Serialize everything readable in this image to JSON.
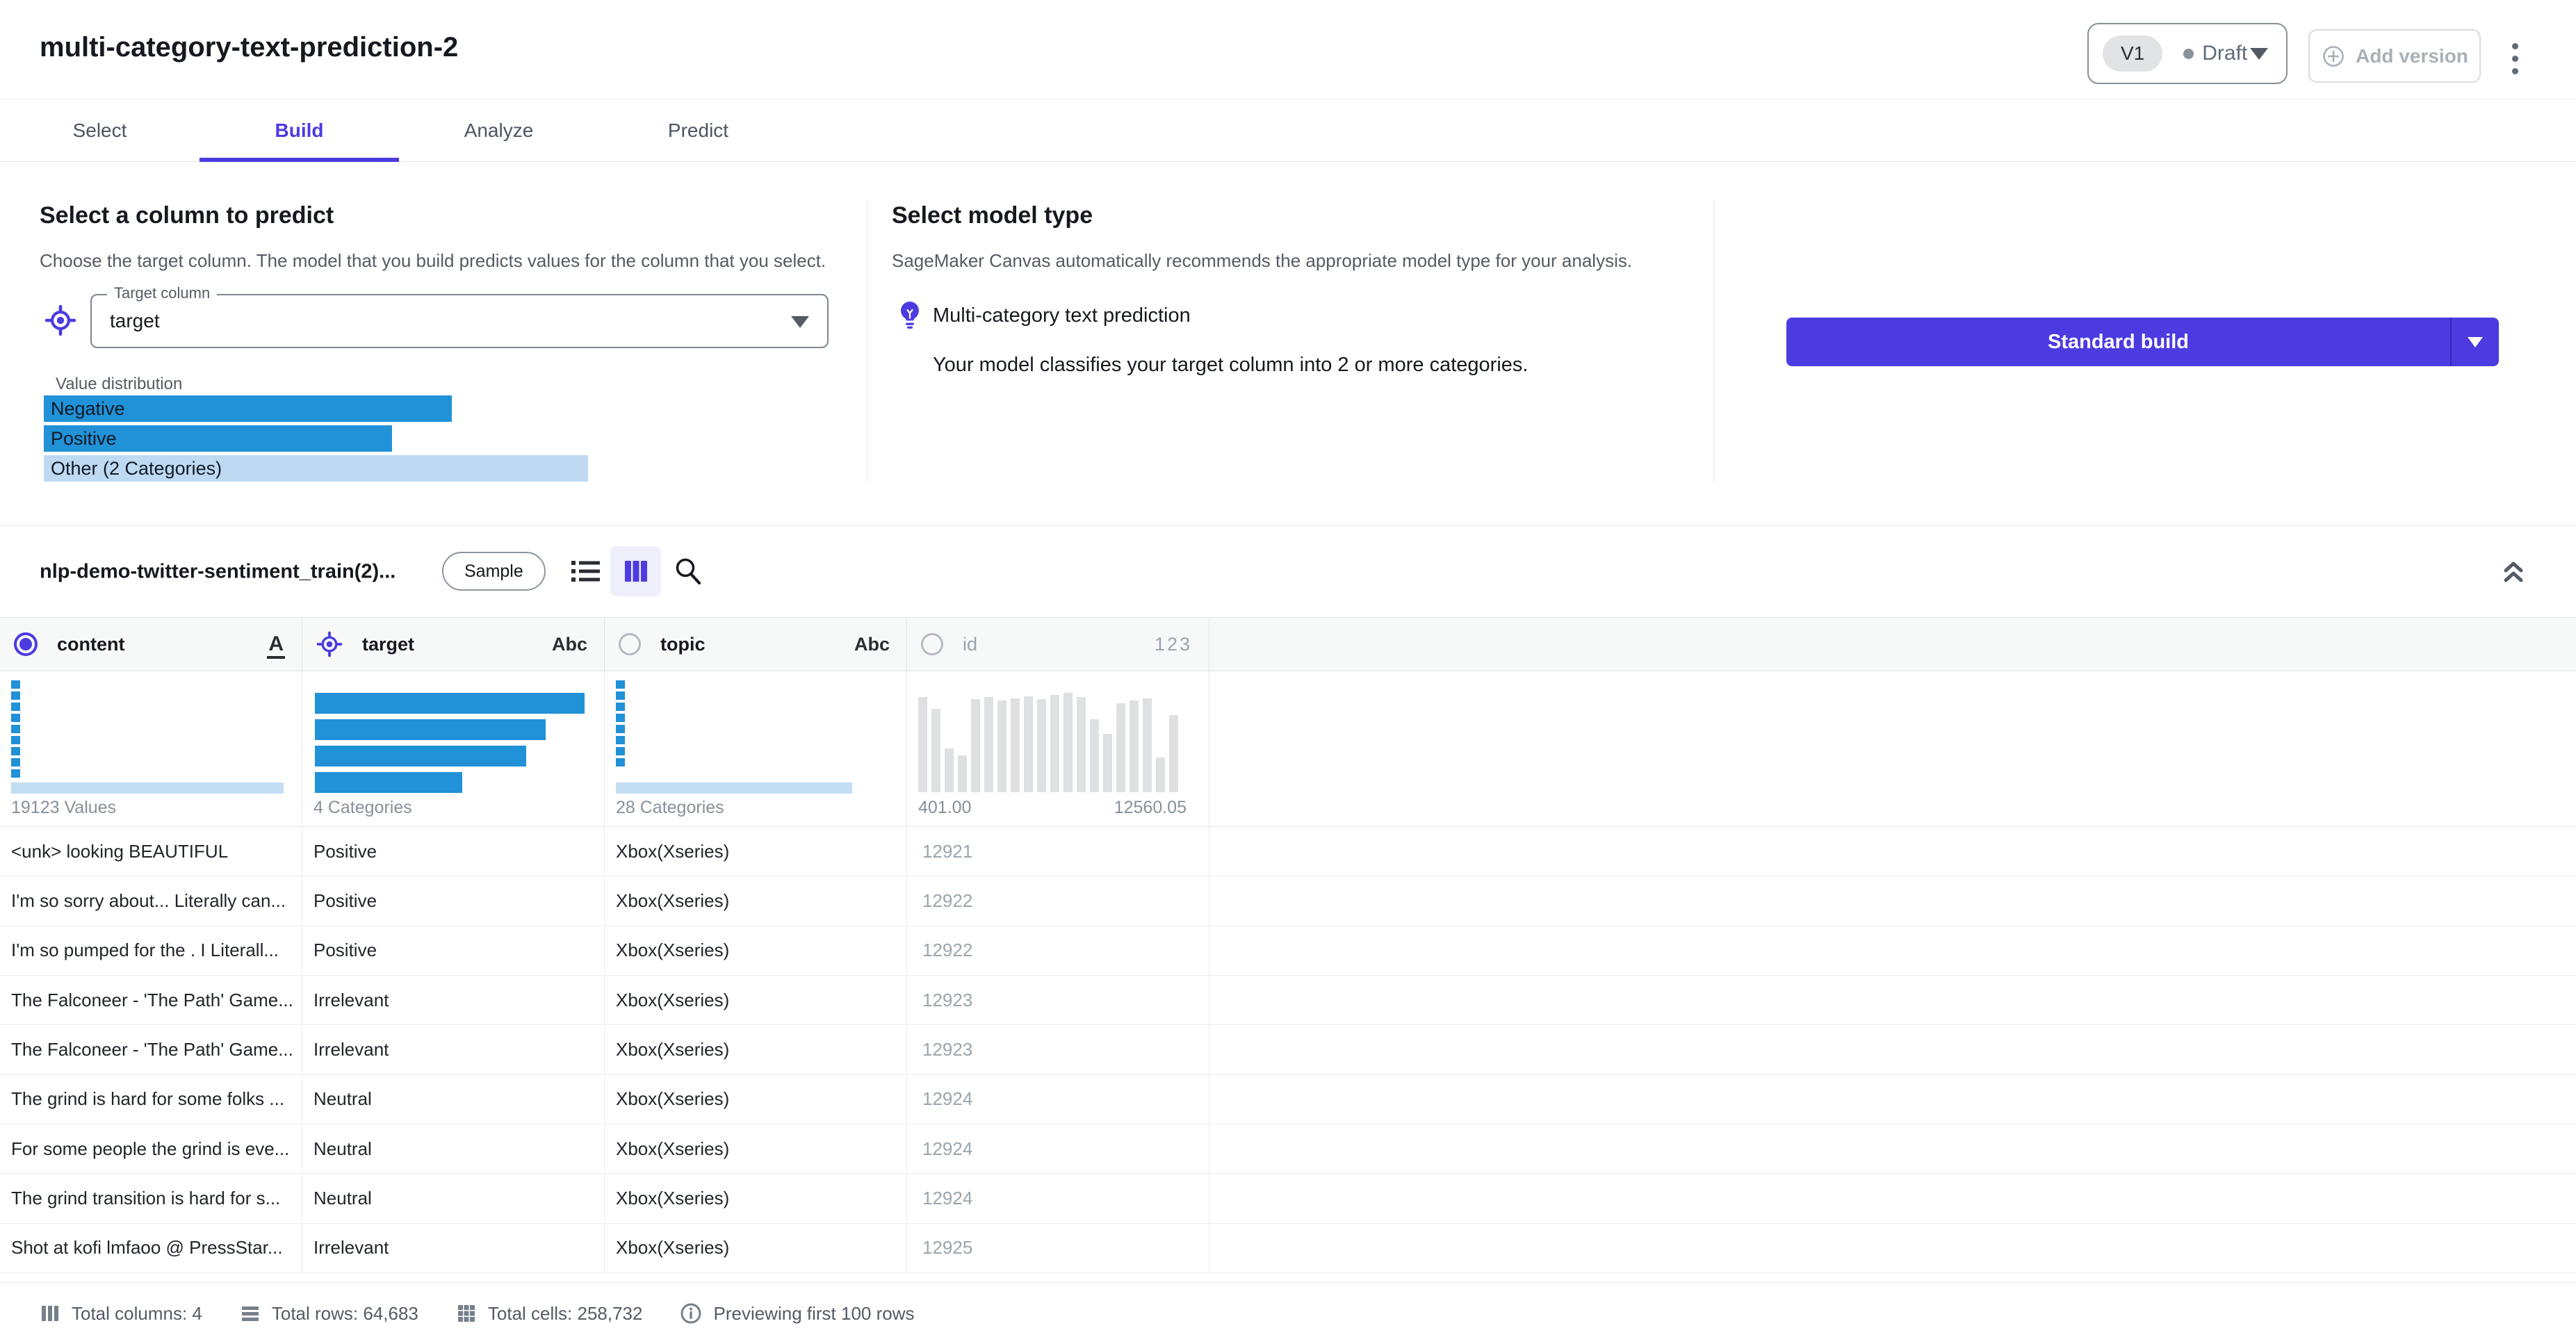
{
  "colors": {
    "accent": "#4b3be0",
    "bar_blue": "#2191d8",
    "bar_light_blue": "#bddaf2",
    "histogram_gray": "#dfe0e2",
    "muted_text": "#9aa5ad"
  },
  "header": {
    "title": "multi-category-text-prediction-2",
    "version_badge": "V1",
    "status": "Draft",
    "add_version_label": "Add version"
  },
  "tabs": [
    {
      "label": "Select",
      "active": false
    },
    {
      "label": "Build",
      "active": true
    },
    {
      "label": "Analyze",
      "active": false
    },
    {
      "label": "Predict",
      "active": false
    }
  ],
  "target_panel": {
    "heading": "Select a column to predict",
    "description": "Choose the target column. The model that you build predicts values for the column that you select.",
    "field_label": "Target column",
    "field_value": "target",
    "distribution_label": "Value distribution",
    "bars": [
      {
        "label": "Negative",
        "width_pct": 75,
        "light": false
      },
      {
        "label": "Positive",
        "width_pct": 64,
        "light": false
      },
      {
        "label": "Other (2 Categories)",
        "width_pct": 100,
        "light": true
      }
    ]
  },
  "model_panel": {
    "heading": "Select model type",
    "description": "SageMaker Canvas automatically recommends the appropriate model type for your analysis.",
    "model_name": "Multi-category text prediction",
    "model_detail": "Your model classifies your target column into 2 or more categories."
  },
  "build": {
    "primary_label": "Standard build"
  },
  "dataset": {
    "name": "nlp-demo-twitter-sentiment_train(2)...",
    "badge": "Sample"
  },
  "table": {
    "columns": [
      {
        "name": "content",
        "type": "A",
        "icon": "radio-selected",
        "muted": false
      },
      {
        "name": "target",
        "type": "Abc",
        "icon": "target",
        "muted": false
      },
      {
        "name": "topic",
        "type": "Abc",
        "icon": "radio",
        "muted": false
      },
      {
        "name": "id",
        "type": "123",
        "icon": "radio",
        "muted": true
      }
    ],
    "histograms": [
      {
        "kind": "squares",
        "squares": 9,
        "flat_bar_pct": 98,
        "caption": "19123 Values"
      },
      {
        "kind": "hbars",
        "widths_pct": [
          97,
          83,
          76,
          53
        ],
        "caption": "4 Categories"
      },
      {
        "kind": "squares",
        "squares": 8,
        "flat_bar_pct": 85,
        "caption": "28 Categories"
      },
      {
        "kind": "vbars",
        "values_pct": [
          95,
          83,
          44,
          37,
          93,
          95,
          92,
          94,
          96,
          93,
          97,
          99,
          95,
          73,
          58,
          89,
          92,
          94,
          35,
          77
        ],
        "min_label": "401.00",
        "max_label": "12560.05"
      }
    ],
    "rows": [
      [
        "<unk> looking BEAUTIFUL",
        "Positive",
        "Xbox(Xseries)",
        "12921"
      ],
      [
        "I'm so sorry about... Literally can...",
        "Positive",
        "Xbox(Xseries)",
        "12922"
      ],
      [
        "I'm so pumped for the . I Literall...",
        "Positive",
        "Xbox(Xseries)",
        "12922"
      ],
      [
        "The Falconeer - 'The Path' Game...",
        "Irrelevant",
        "Xbox(Xseries)",
        "12923"
      ],
      [
        "The Falconeer - 'The Path' Game...",
        "Irrelevant",
        "Xbox(Xseries)",
        "12923"
      ],
      [
        "The grind is hard for some folks ...",
        "Neutral",
        "Xbox(Xseries)",
        "12924"
      ],
      [
        "For some people the grind is eve...",
        "Neutral",
        "Xbox(Xseries)",
        "12924"
      ],
      [
        "The grind transition is hard for s...",
        "Neutral",
        "Xbox(Xseries)",
        "12924"
      ],
      [
        "Shot at kofi lmfaoo @ PressStar...",
        "Irrelevant",
        "Xbox(Xseries)",
        "12925"
      ]
    ]
  },
  "footer": {
    "items": [
      {
        "icon": "columns-icon",
        "text": "Total columns: 4"
      },
      {
        "icon": "rows-icon",
        "text": "Total rows: 64,683"
      },
      {
        "icon": "cells-icon",
        "text": "Total cells: 258,732"
      },
      {
        "icon": "info-icon",
        "text": "Previewing first 100 rows"
      }
    ]
  }
}
